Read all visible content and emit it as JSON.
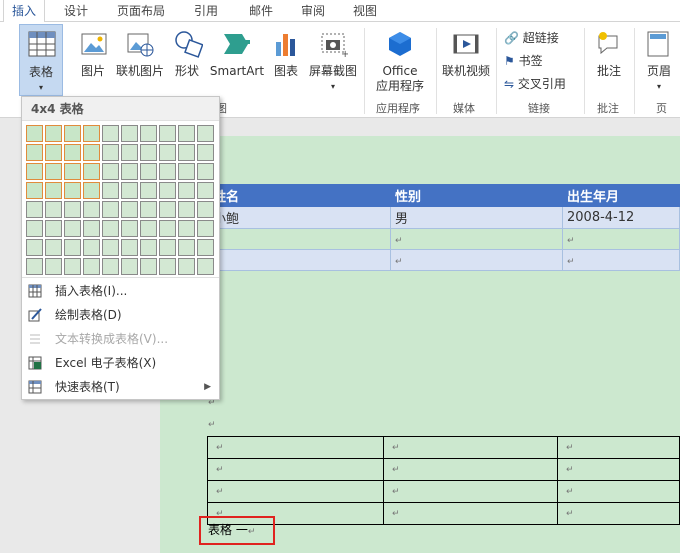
{
  "tabs": [
    "插入",
    "设计",
    "页面布局",
    "引用",
    "邮件",
    "审阅",
    "视图"
  ],
  "ribbon": {
    "table": "表格",
    "picture": "图片",
    "online_picture": "联机图片",
    "shapes": "形状",
    "smartart": "SmartArt",
    "chart": "图表",
    "screenshot": "屏幕截图",
    "office_apps_1": "Office",
    "office_apps_2": "应用程序",
    "online_video": "联机视频",
    "hyperlink": "超链接",
    "bookmark": "书签",
    "cross_ref": "交叉引用",
    "comment": "批注",
    "header": "页眉",
    "groups": {
      "illustrations": "图",
      "apps": "应用程序",
      "media": "媒体",
      "links": "链接",
      "comments": "批注",
      "headerfooter": "页"
    }
  },
  "menu": {
    "title": "4x4 表格",
    "items": [
      {
        "label": "插入表格(I)...",
        "disabled": false
      },
      {
        "label": "绘制表格(D)",
        "disabled": false
      },
      {
        "label": "文本转换成表格(V)...",
        "disabled": true
      },
      {
        "label": "Excel 电子表格(X)",
        "disabled": false
      },
      {
        "label": "快速表格(T)",
        "disabled": false
      }
    ],
    "selected_rows": 4,
    "selected_cols": 4,
    "grid_rows": 8,
    "grid_cols": 10
  },
  "table1": {
    "headers": [
      "姓名",
      "性别",
      "出生年月"
    ],
    "rows": [
      [
        "小鲍",
        "男",
        "2008-4-12"
      ]
    ]
  },
  "caption": "表格 一",
  "colors": {
    "accent": "#2b579a",
    "header_blue": "#4472c4",
    "page_green": "#cce8cf",
    "highlight": "#e0231f"
  }
}
